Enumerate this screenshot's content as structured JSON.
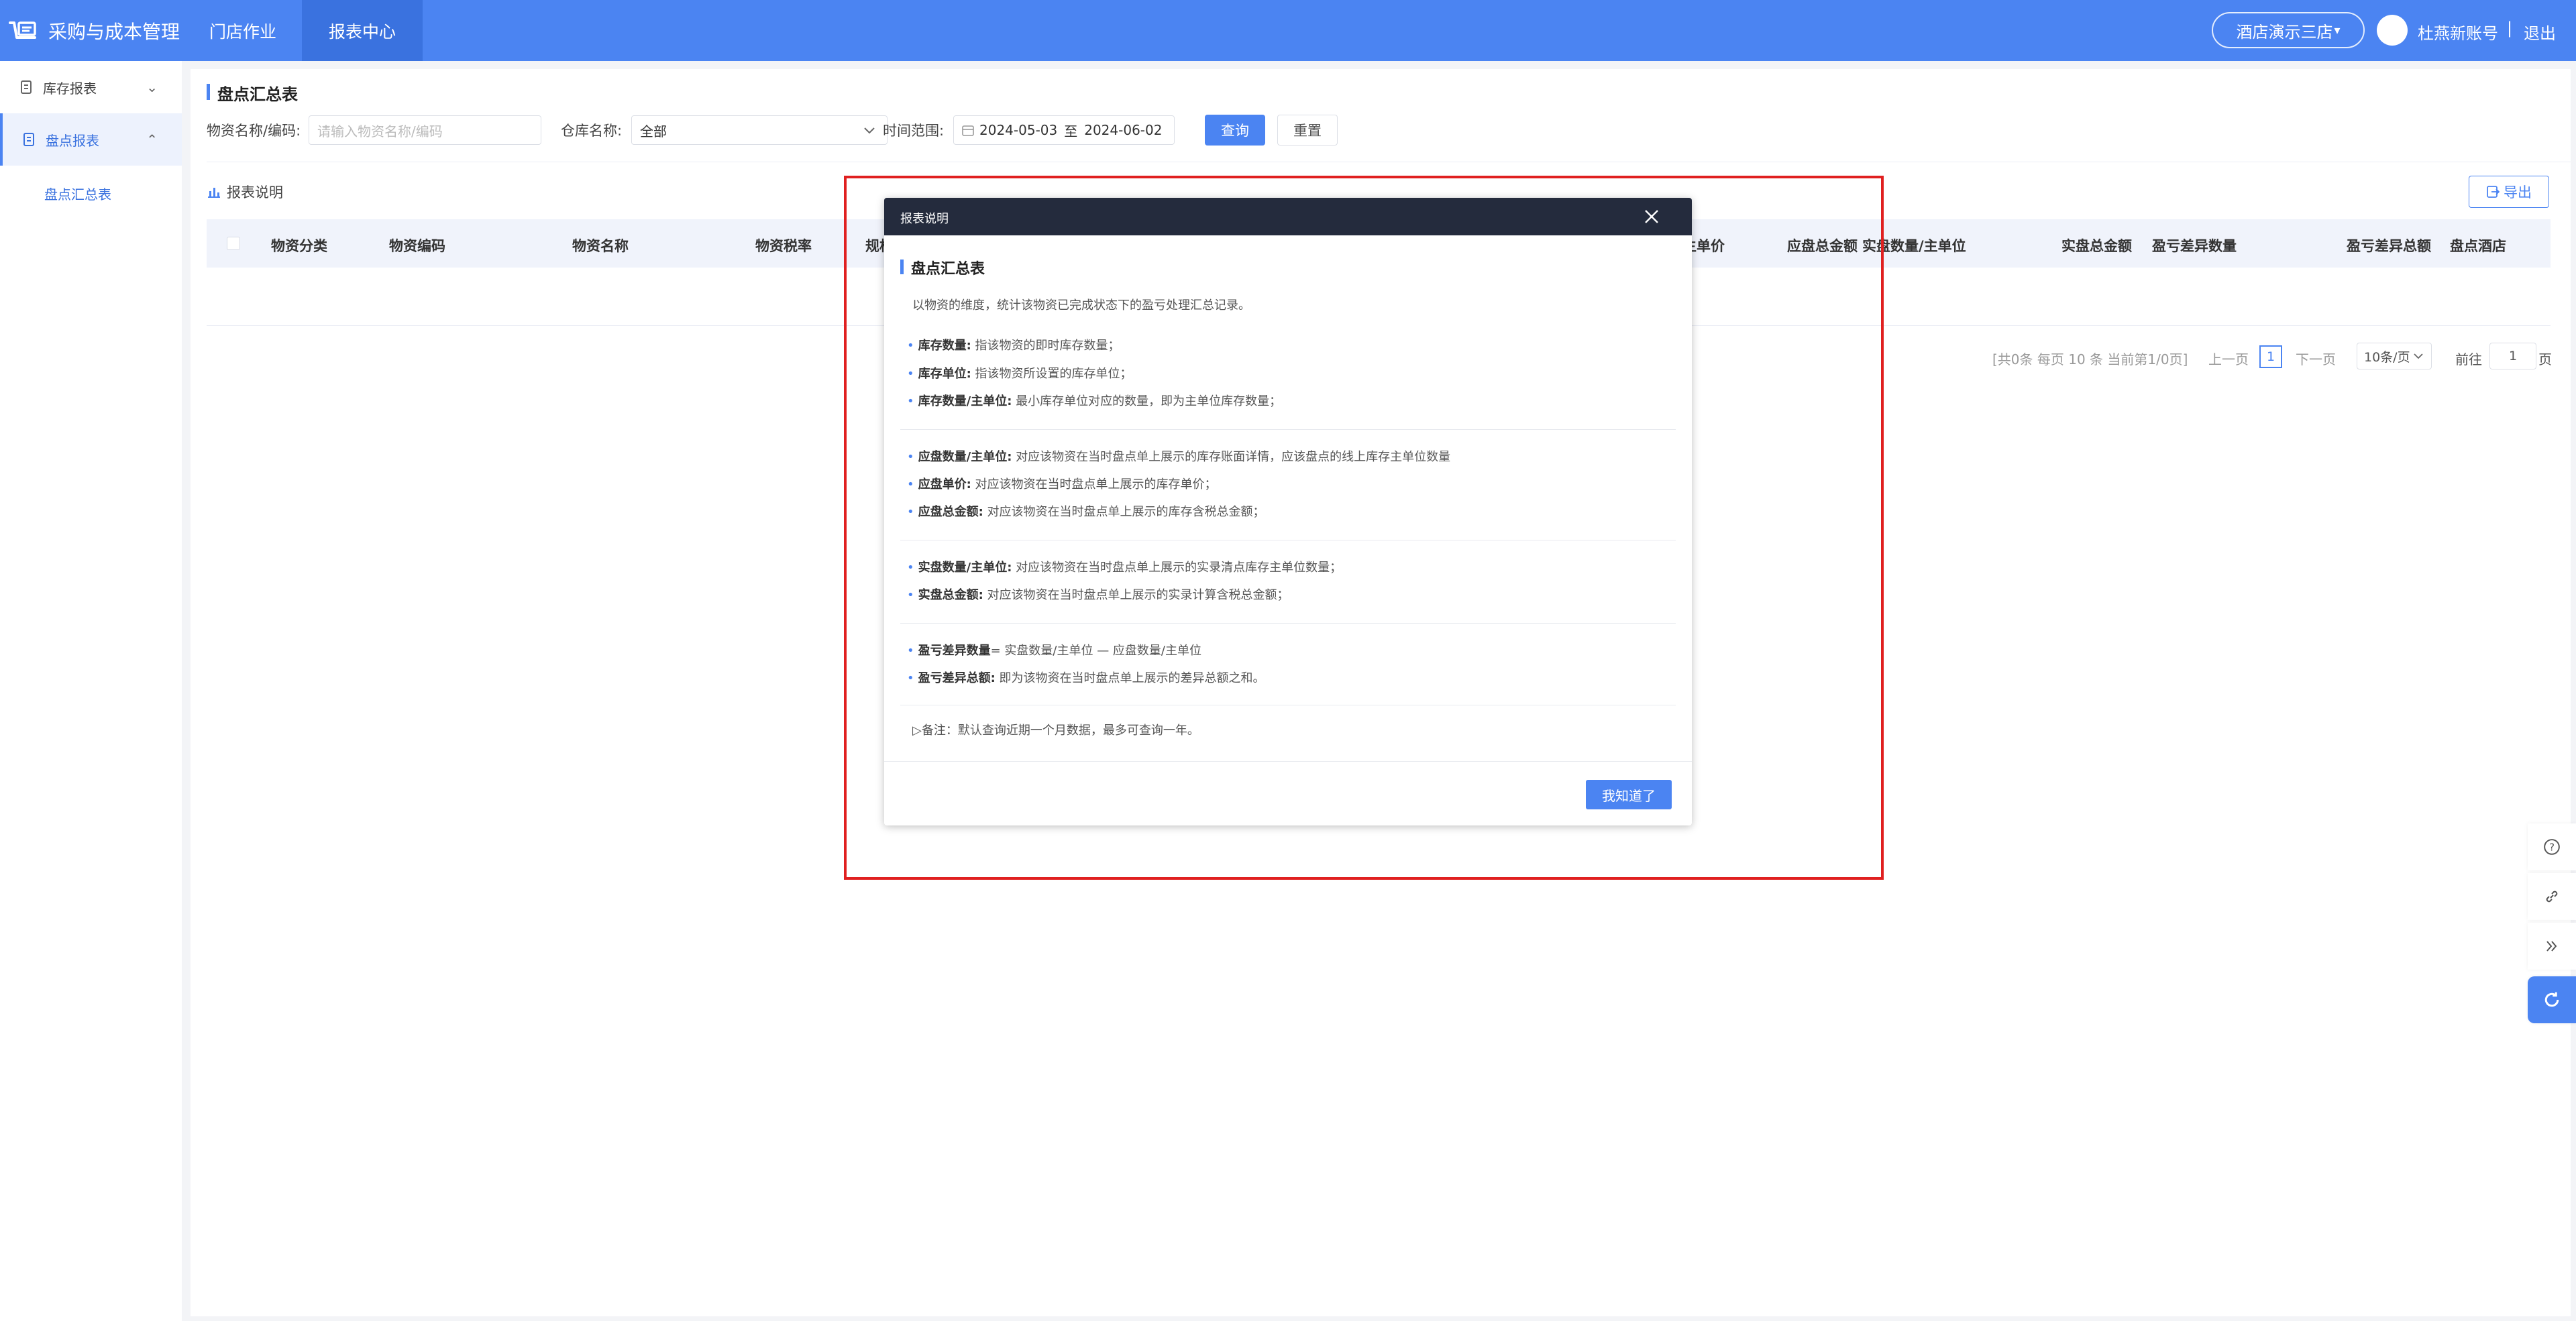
{
  "header": {
    "app_title": "采购与成本管理",
    "nav": [
      {
        "label": "门店作业"
      },
      {
        "label": "报表中心"
      }
    ],
    "store": "酒店演示三店",
    "store_caret": "▾",
    "user": "杜燕新账号",
    "sep": "|",
    "logout": "退出"
  },
  "sidebar": {
    "items": [
      {
        "label": "库存报表",
        "chevron": "⌄"
      },
      {
        "label": "盘点报表",
        "chevron": "⌃"
      }
    ],
    "sub": "盘点汇总表"
  },
  "page": {
    "title": "盘点汇总表",
    "filters": {
      "item_label": "物资名称/编码:",
      "item_placeholder": "请输入物资名称/编码",
      "warehouse_label": "仓库名称:",
      "warehouse_value": "全部",
      "date_label": "时间范围:",
      "date_start": "2024-05-03",
      "date_to": "至",
      "date_end": "2024-06-02"
    },
    "query": "查询",
    "reset": "重置",
    "report_doc": "报表说明",
    "export": "导出",
    "columns": [
      "物资分类",
      "物资编码",
      "物资名称",
      "物资税率",
      "规格",
      "主单价",
      "应盘总金额",
      "实盘数量/主单位",
      "实盘总金额",
      "盈亏差异数量",
      "盈亏差异总额",
      "盘点酒店"
    ],
    "pagination": {
      "summary": "[共0条 每页 10 条 当前第1/0页]",
      "prev": "上一页",
      "current": "1",
      "next": "下一页",
      "page_size": "10条/页",
      "goto_label": "前往",
      "goto_value": "1",
      "goto_suffix": "页"
    }
  },
  "modal": {
    "title": "报表说明",
    "heading": "盘点汇总表",
    "desc": "以物资的维度，统计该物资已完成状态下的盈亏处理汇总记录。",
    "groups": [
      [
        {
          "term": "库存数量:",
          "text": " 指该物资的即时库存数量；"
        },
        {
          "term": "库存单位:",
          "text": " 指该物资所设置的库存单位；"
        },
        {
          "term": "库存数量/主单位:",
          "text": " 最小库存单位对应的数量，即为主单位库存数量；"
        }
      ],
      [
        {
          "term": "应盘数量/主单位:",
          "text": " 对应该物资在当时盘点单上展示的库存账面详情，应该盘点的线上库存主单位数量"
        },
        {
          "term": "应盘单价:",
          "text": " 对应该物资在当时盘点单上展示的库存单价；"
        },
        {
          "term": "应盘总金额:",
          "text": " 对应该物资在当时盘点单上展示的库存含税总金额；"
        }
      ],
      [
        {
          "term": "实盘数量/主单位:",
          "text": " 对应该物资在当时盘点单上展示的实录清点库存主单位数量；"
        },
        {
          "term": "实盘总金额:",
          "text": " 对应该物资在当时盘点单上展示的实录计算含税总金额；"
        }
      ],
      [
        {
          "term": "盈亏差异数量",
          "text": "= 实盘数量/主单位 — 应盘数量/主单位"
        },
        {
          "term": "盈亏差异总额:",
          "text": " 即为该物资在当时盘点单上展示的差异总额之和。"
        }
      ]
    ],
    "note": "▷备注：默认查询近期一个月数据，最多可查询一年。",
    "ok": "我知道了"
  },
  "float_tools": [
    "help-icon",
    "link-icon",
    "collapse-icon",
    "refresh-icon"
  ],
  "colors": {
    "brand": "#4b84f2",
    "modal_header": "#242b3d",
    "highlight": "#e02020"
  }
}
